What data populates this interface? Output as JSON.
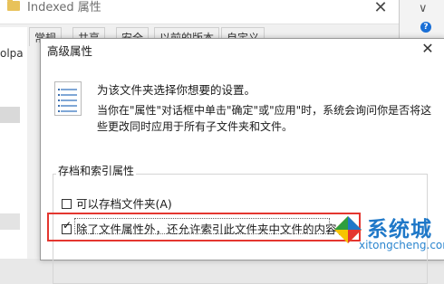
{
  "bg_window": {
    "title": "Indexed 属性",
    "close": "✕",
    "tabs": [
      "常规",
      "共享",
      "安全",
      "以前的版本",
      "自定义"
    ]
  },
  "explorer": {
    "path_fragment": "olpa"
  },
  "right_strip": {
    "chevron": "∨",
    "help": "?",
    "scroll_up": "▲"
  },
  "dialog": {
    "title": "高级属性",
    "close": "✕",
    "description_line1": "为该文件夹选择你想要的设置。",
    "description_line2": "当你在\"属性\"对话框中单击\"确定\"或\"应用\"时，系统会询问你是否将这",
    "description_line3": "些更改同时应用于所有子文件夹和文件。",
    "group_label": "存档和索引属性",
    "checkboxes": [
      {
        "label": "可以存档文件夹(A)",
        "checked": false
      },
      {
        "label": "除了文件属性外，还允许索引此文件夹中文件的内容(I)",
        "checked": true
      }
    ]
  },
  "watermark": {
    "text": "系统城",
    "url": "xitongcheng.com"
  },
  "colors": {
    "highlight": "#e4362f",
    "watermark_blue": "#1f78c8"
  }
}
